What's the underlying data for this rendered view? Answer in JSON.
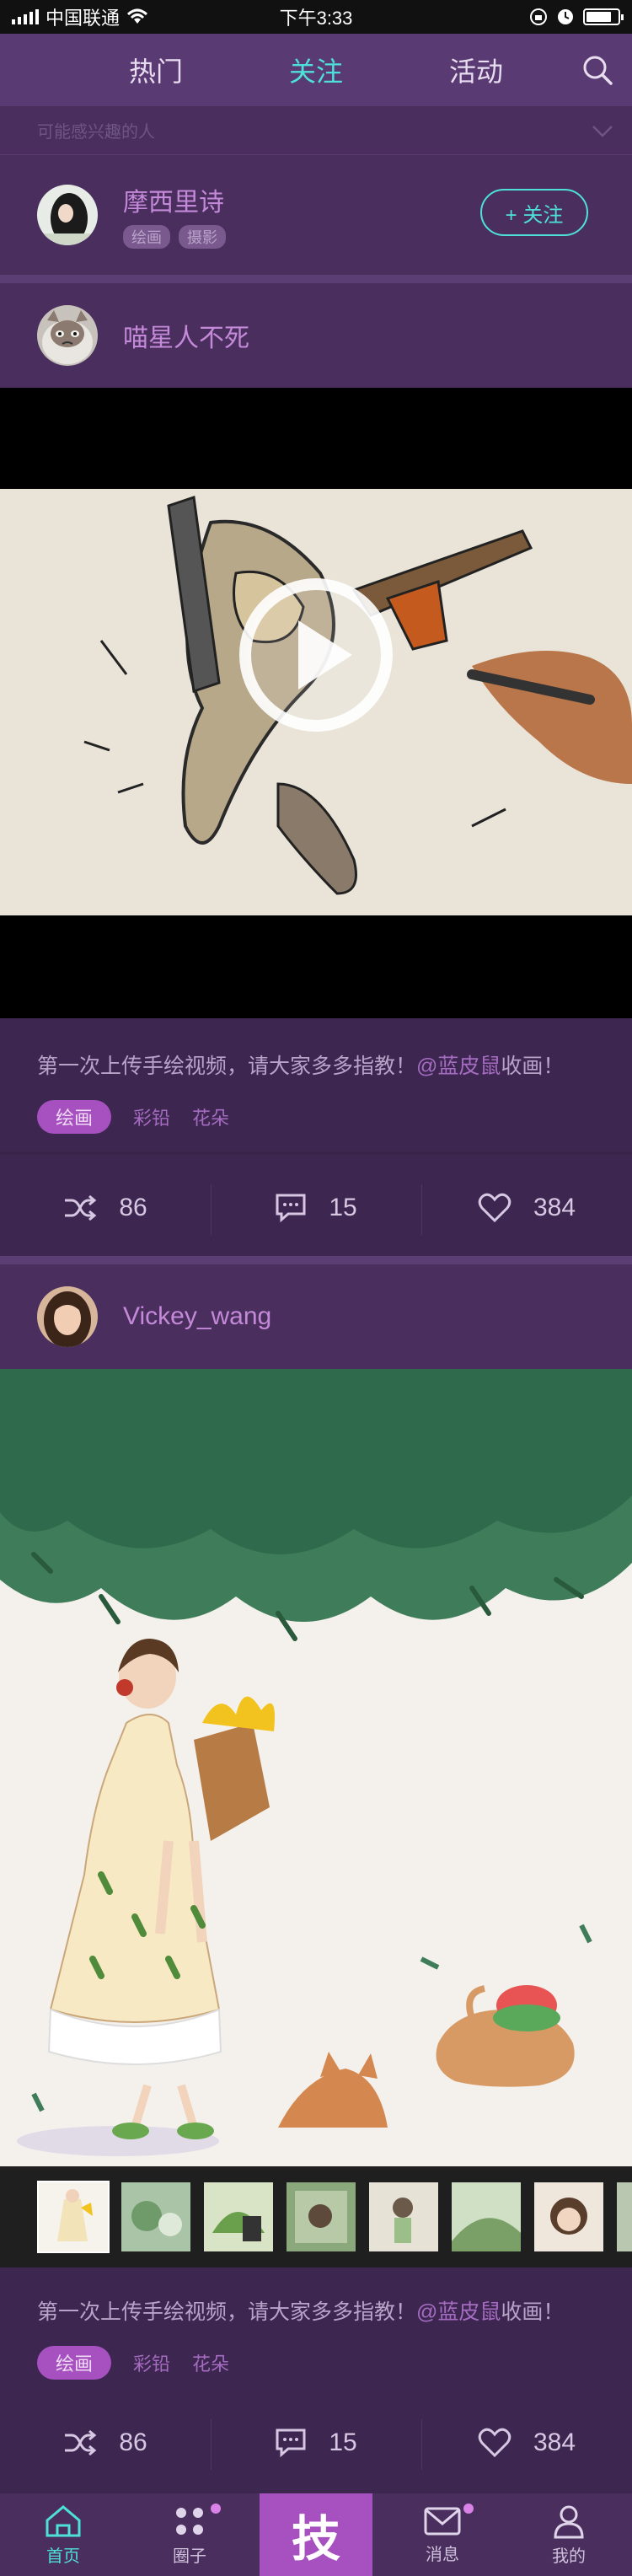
{
  "status_bar": {
    "carrier": "中国联通",
    "time": "下午3:33"
  },
  "top_nav": {
    "tabs": [
      {
        "label": "热门",
        "active": false
      },
      {
        "label": "关注",
        "active": true
      },
      {
        "label": "活动",
        "active": false
      }
    ]
  },
  "suggestions": {
    "header": "可能感兴趣的人",
    "user": {
      "name": "摩西里诗",
      "tags": [
        "绘画",
        "摄影"
      ],
      "follow_label": "+ 关注"
    }
  },
  "posts": [
    {
      "author": "喵星人不死",
      "media_type": "video",
      "caption_text": "第一次上传手绘视频，请大家多多指教！",
      "mention": "@蓝皮鼠",
      "caption_suffix": "收画！",
      "tags": [
        {
          "label": "绘画",
          "active": true
        },
        {
          "label": "彩铅",
          "active": false
        },
        {
          "label": "花朵",
          "active": false
        }
      ],
      "shares": "86",
      "comments": "15",
      "likes": "384"
    },
    {
      "author": "Vickey_wang",
      "media_type": "image",
      "caption_text": "第一次上传手绘视频，请大家多多指教！",
      "mention": "@蓝皮鼠",
      "caption_suffix": "收画！",
      "tags": [
        {
          "label": "绘画",
          "active": true
        },
        {
          "label": "彩铅",
          "active": false
        },
        {
          "label": "花朵",
          "active": false
        }
      ],
      "shares": "86",
      "comments": "15",
      "likes": "384"
    }
  ],
  "tab_bar": {
    "items": [
      {
        "label": "首页",
        "active": true
      },
      {
        "label": "圈子",
        "active": false
      },
      {
        "label": "技",
        "active": false
      },
      {
        "label": "消息",
        "active": false
      },
      {
        "label": "我的",
        "active": false
      }
    ]
  },
  "colors": {
    "accent": "#4ee0d8",
    "purple_text": "#c489d8",
    "tag_active_bg": "#a651bf",
    "background": "#3a2449"
  }
}
